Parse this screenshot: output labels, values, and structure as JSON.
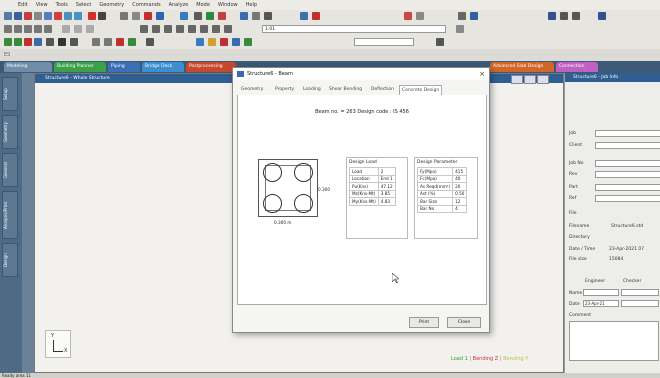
{
  "menu": [
    "Edit",
    "View",
    "Tools",
    "Select",
    "Geometry",
    "Commands",
    "Analyze",
    "Mode",
    "Window",
    "Help"
  ],
  "toolbar": {
    "combo1": "1:01",
    "combo2": ""
  },
  "left_label": "ES",
  "tabs": [
    {
      "label": "Modeling",
      "color": "#6f8ca8"
    },
    {
      "label": "Building Planner",
      "color": "#3aa14a"
    },
    {
      "label": "Piping",
      "color": "#3b6fb6"
    },
    {
      "label": "Bridge Deck",
      "color": "#3b8fd0"
    },
    {
      "label": "Postprocessing",
      "color": "#c8482f"
    },
    {
      "label": "Advanced Slab Design",
      "color": "#d2662a"
    },
    {
      "label": "Connection",
      "color": "#c060c0"
    }
  ],
  "side_tabs": [
    "Setup",
    "Geometry",
    "General",
    "Analysis/Print",
    "Design"
  ],
  "main_view_title": "Structure6 - Whole Structure",
  "right_panel": {
    "title": "Structure6 - Job Info",
    "fields": [
      "Job",
      "Client",
      "Job No",
      "Rev",
      "Part",
      "Ref",
      "File"
    ],
    "filename_label": "Filename",
    "filename_value": "Structure6.std",
    "directory_label": "Directory",
    "datetime_label": "Date / Time",
    "datetime_value": "23-Apr-2021  07",
    "filesize_label": "File size",
    "filesize_value": "15084",
    "engineer_label": "Engineer",
    "checker_label": "Checker",
    "name_label": "Name",
    "date_label": "Date",
    "date_value": "23-Apr-21",
    "comment_label": "Comment"
  },
  "dialog": {
    "title": "Structure6 - Beam",
    "close_glyph": "×",
    "tabs": [
      "Geometry",
      "Property",
      "Loading",
      "Shear Bending",
      "Deflection",
      "Concrete Design"
    ],
    "active_tab": "Concrete Design",
    "beam_info": "Beam no. = 263  Design code : IS 456",
    "dim_vertical": "0.300",
    "dim_horizontal": "0.300 m",
    "design_load_title": "Design Load",
    "design_load": [
      [
        "Load",
        "2"
      ],
      [
        "Location",
        "End 1"
      ],
      [
        "Pu(Kns)",
        "47.12"
      ],
      [
        "Mz(Kns-Mt)",
        "3.85"
      ],
      [
        "My(Kns-Mt)",
        "4.83"
      ]
    ],
    "design_param_title": "Design Parameter",
    "design_param": [
      [
        "Fy(Mpa)",
        "415"
      ],
      [
        "Fc(Mpa)",
        "40"
      ],
      [
        "As Reqd(mm²)",
        "20"
      ],
      [
        "Ast (%)",
        "0.50"
      ],
      [
        "Bar Size",
        "12"
      ],
      [
        "Bar No",
        "4"
      ]
    ],
    "print_label": "Print",
    "close_label": "Close"
  },
  "view_footer": [
    {
      "label": "Load 1",
      "color": "#2aa02a"
    },
    {
      "label": "Bending Z",
      "color": "#d03030"
    },
    {
      "label": "Bending Y",
      "color": "#c0c030"
    }
  ],
  "axis": {
    "y": "Y",
    "x": "X"
  },
  "status_text": "Ready  area 11"
}
